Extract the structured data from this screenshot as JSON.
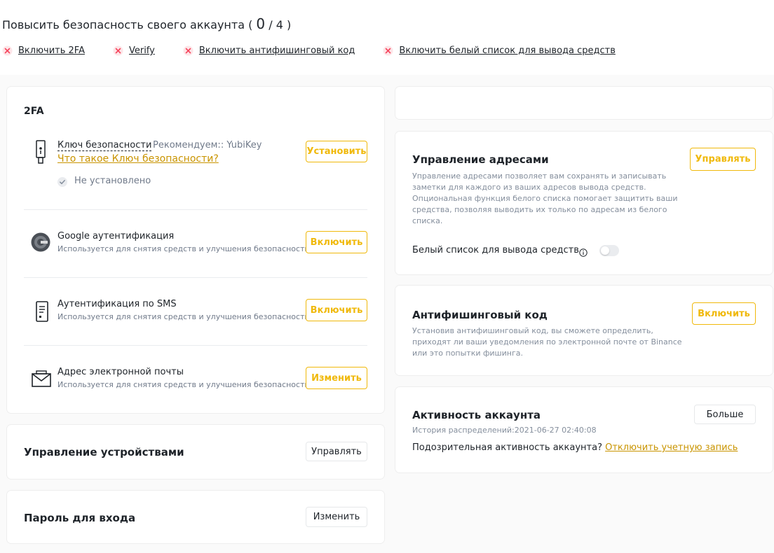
{
  "progress": {
    "title": "Повысить безопасность своего аккаунта (",
    "done": "0",
    "total": "/ 4 )"
  },
  "tasks": [
    {
      "label": "Включить 2FA"
    },
    {
      "label": "Verify"
    },
    {
      "label": "Включить антифишинговый код"
    },
    {
      "label": "Включить белый список для вывода средств"
    }
  ],
  "twofa": {
    "title": "2FA",
    "security_key": {
      "name": "Ключ безопасности",
      "recommend": "Рекомендуем:: YubiKey",
      "link": "Что такое Ключ безопасности?",
      "status": "Не установлено",
      "button": "Установить"
    },
    "google": {
      "name": "Google аутентификация",
      "desc": "Используется для снятия средств и улучшения безопасности",
      "button": "Включить"
    },
    "sms": {
      "name": "Аутентификация по SMS",
      "desc": "Используется для снятия средств и улучшения безопасности",
      "button": "Включить"
    },
    "email": {
      "name": "Адрес электронной почты",
      "desc": "Используется для снятия средств и улучшения безопасности",
      "button": "Изменить"
    }
  },
  "devices": {
    "title": "Управление устройствами",
    "button": "Управлять"
  },
  "password": {
    "title": "Пароль для входа",
    "button": "Изменить"
  },
  "address": {
    "title": "Управление адресами",
    "desc1": "Управление адресами позволяет вам сохранять и записывать",
    "desc2": "заметки для каждого из ваших адресов вывода средств.",
    "desc3": "Опциональная функция белого списка помогает защитить ваши",
    "desc4": "средства, позволяя выводить их только по адресам из белого",
    "desc5": "списка.",
    "whitelist_label": "Белый список для вывода средств",
    "button": "Управлять"
  },
  "antiphish": {
    "title": "Антифишинговый код",
    "desc1": "Установив антифишинговый код, вы сможете определить,",
    "desc2": "приходят ли ваши уведомления по электронной почте от Binance",
    "desc3": "или это попытки фишинга.",
    "button": "Включить"
  },
  "activity": {
    "title": "Активность аккаунта",
    "history": "История распределений:2021-06-27 02:40:08",
    "question": "Подозрительная активность аккаунта?",
    "link": "Отключить учетную запись",
    "button": "Больше"
  },
  "colors": {
    "accent": "#f0b90b",
    "error": "#f6465d",
    "background": "#fafafa"
  },
  "icons": [
    "close-circle-icon",
    "usb-key-icon",
    "google-auth-icon",
    "sms-phone-icon",
    "email-envelope-icon",
    "check-icon",
    "info-icon"
  ]
}
